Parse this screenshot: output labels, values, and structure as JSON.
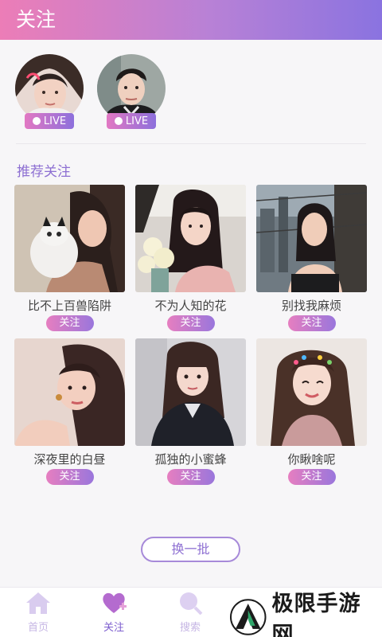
{
  "header": {
    "title": "关注"
  },
  "live": {
    "badge_label": "LIVE",
    "users": [
      {
        "name": "live-user-1"
      },
      {
        "name": "live-user-2"
      }
    ]
  },
  "recommend": {
    "title": "推荐关注",
    "follow_label": "关注",
    "cards": [
      {
        "name": "比不上百兽陷阱"
      },
      {
        "name": "不为人知的花"
      },
      {
        "name": "别找我麻烦"
      },
      {
        "name": "深夜里的白昼"
      },
      {
        "name": "孤独的小蜜蜂"
      },
      {
        "name": "你瞅啥呢"
      }
    ]
  },
  "refresh_label": "换一批",
  "tabbar": {
    "tabs": [
      {
        "label": "首页",
        "icon": "house-icon"
      },
      {
        "label": "关注",
        "icon": "heart-plus-icon"
      },
      {
        "label": "搜索",
        "icon": "search-icon"
      }
    ]
  },
  "watermark": {
    "text": "极限手游网"
  },
  "colors": {
    "accent": "#8d6fd2",
    "gradient_start": "#ec7db7",
    "gradient_end": "#8a73e0"
  }
}
